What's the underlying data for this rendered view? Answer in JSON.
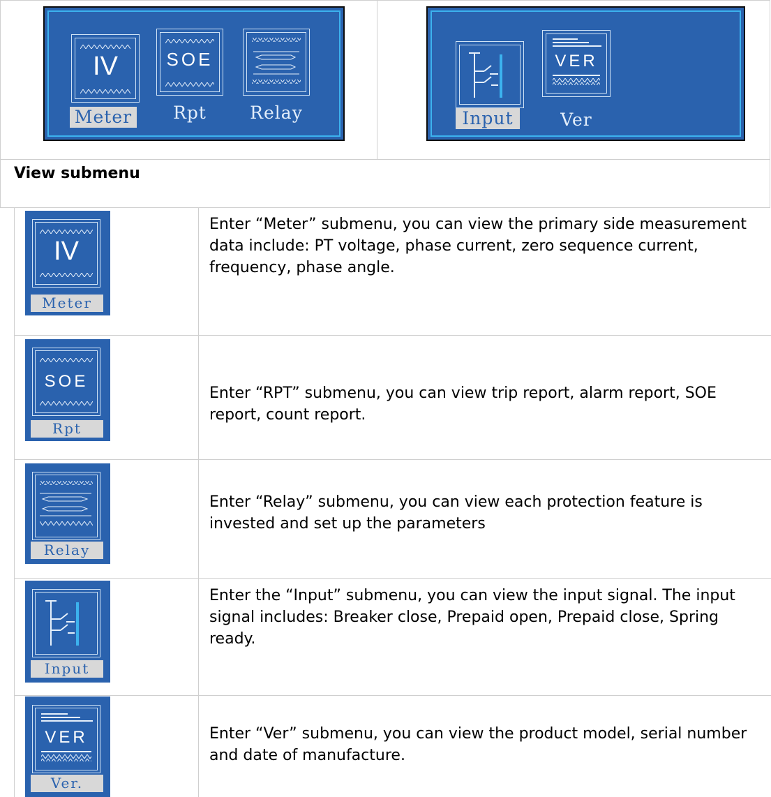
{
  "top": {
    "left_screen": {
      "items": [
        "Meter",
        "Rpt",
        "Relay"
      ],
      "icons": [
        "IV",
        "SOE",
        ""
      ]
    },
    "right_screen": {
      "items": [
        "Input",
        "Ver"
      ],
      "icons": [
        "",
        "VER"
      ]
    }
  },
  "section_title": "View submenu",
  "rows": [
    {
      "icon_text": "IV",
      "label": "Meter",
      "desc": "Enter “Meter” submenu, you can view the primary side measurement data include: PT voltage, phase current, zero sequence current, frequency, phase angle."
    },
    {
      "icon_text": "SOE",
      "label": "Rpt",
      "desc": "Enter “RPT” submenu, you can view trip report, alarm report, SOE report, count report."
    },
    {
      "icon_text": "",
      "label": "Relay",
      "desc": "Enter “Relay” submenu, you can view each protection feature is invested and set up the parameters"
    },
    {
      "icon_text": "",
      "label": "Input",
      "desc": "Enter the “Input” submenu, you can view the input signal. The input signal includes: Breaker close, Prepaid open, Prepaid close, Spring ready."
    },
    {
      "icon_text": "VER",
      "label": "Ver.",
      "desc": "Enter “Ver” submenu, you can view the product model, serial number and date of manufacture."
    }
  ],
  "colors": {
    "lcd_blue": "#2a62ae",
    "lcd_border": "#3cb2ee",
    "label_bg": "#d8d8d8"
  }
}
